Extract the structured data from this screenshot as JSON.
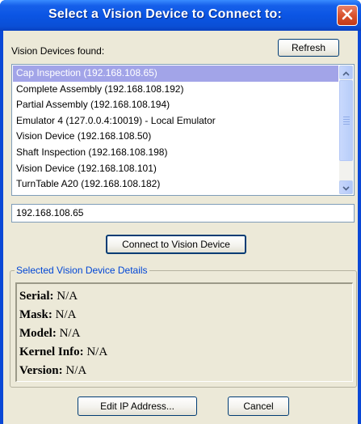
{
  "window": {
    "title": "Select a Vision Device to Connect to:",
    "close_icon": "close-icon"
  },
  "found_label": "Vision Devices found:",
  "refresh_label": "Refresh",
  "devices": [
    "Cap Inspection  (192.168.108.65)",
    "Complete Assembly (192.168.108.192)",
    "Partial Assembly (192.168.108.194)",
    "Emulator 4   (127.0.0.4:10019) - Local Emulator",
    "Vision Device   (192.168.108.50)",
    "Shaft Inspection (192.168.108.198)",
    "Vision Device   (192.168.108.101)",
    "TurnTable A20   (192.168.108.182)"
  ],
  "selected_index": 0,
  "ip_value": "192.168.108.65",
  "connect_label": "Connect to Vision Device",
  "details_group_label": "Selected Vision Device Details",
  "details": [
    {
      "label": "Serial:",
      "value": "N/A"
    },
    {
      "label": "Mask:",
      "value": "N/A"
    },
    {
      "label": "Model:",
      "value": "N/A"
    },
    {
      "label": "Kernel Info:",
      "value": "N/A"
    },
    {
      "label": "Version:",
      "value": "N/A"
    }
  ],
  "edit_ip_label": "Edit IP Address...",
  "cancel_label": "Cancel",
  "colors": {
    "title_bar": "#0a55e4",
    "selection": "#a2a4e8",
    "group_label": "#0046d5",
    "dialog_bg": "#ece9d8"
  }
}
